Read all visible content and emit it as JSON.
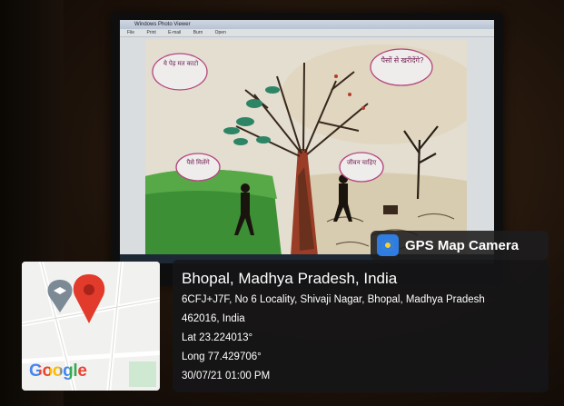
{
  "photo": {
    "description_colors": {
      "accent_blue": "#2f7de1",
      "pin_red": "#e23b2b",
      "pin_grey": "#7c8a96"
    }
  },
  "screen": {
    "window_title": "Windows Photo Viewer",
    "menu": [
      "File",
      "Print",
      "E-mail",
      "Burn",
      "Open"
    ]
  },
  "painting": {
    "bubbles": [
      "ये पेड़ मत काटो",
      "पैसों से खरीदेंगे?",
      "पैसे मिलेंगे",
      "जीवन चाहिए"
    ]
  },
  "badge": {
    "label": "GPS Map Camera",
    "icon": "gps-camera-icon"
  },
  "location": {
    "place": "Bhopal, Madhya Pradesh, India",
    "address": "6CFJ+J7F, No 6 Locality, Shivaji Nagar, Bhopal, Madhya Pradesh",
    "postal": "462016, India",
    "lat": "Lat 23.224013°",
    "long": "Long 77.429706°",
    "datetime": "30/07/21 01:00 PM"
  },
  "map": {
    "logo": "Google",
    "icons": [
      "graduation-cap-icon",
      "location-pin-icon"
    ]
  }
}
